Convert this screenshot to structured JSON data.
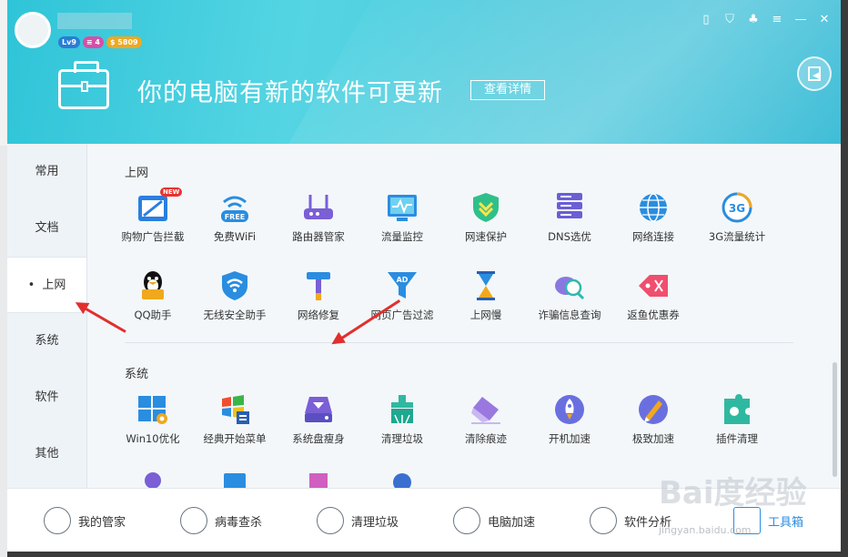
{
  "header": {
    "badges": {
      "level": "Lv9",
      "vip": "≡ 4",
      "coins": "$ 5809"
    },
    "headline": "你的电脑有新的软件可更新",
    "detail_button": "查看详情"
  },
  "sidebar": {
    "items": [
      {
        "label": "常用"
      },
      {
        "label": "文档"
      },
      {
        "label": "上网",
        "active": true
      },
      {
        "label": "系统"
      },
      {
        "label": "软件"
      },
      {
        "label": "其他"
      }
    ]
  },
  "sections": {
    "internet": {
      "title": "上网",
      "items": [
        {
          "label": "购物广告拦截",
          "icon": "ad-block-icon"
        },
        {
          "label": "免费WiFi",
          "icon": "free-wifi-icon"
        },
        {
          "label": "路由器管家",
          "icon": "router-icon"
        },
        {
          "label": "流量监控",
          "icon": "traffic-monitor-icon"
        },
        {
          "label": "网速保护",
          "icon": "speed-shield-icon"
        },
        {
          "label": "DNS选优",
          "icon": "dns-server-icon"
        },
        {
          "label": "网络连接",
          "icon": "globe-icon"
        },
        {
          "label": "3G流量统计",
          "icon": "3g-icon"
        },
        {
          "label": "QQ助手",
          "icon": "qq-penguin-icon"
        },
        {
          "label": "无线安全助手",
          "icon": "wifi-shield-icon"
        },
        {
          "label": "网络修复",
          "icon": "hammer-icon"
        },
        {
          "label": "网页广告过滤",
          "icon": "ad-funnel-icon"
        },
        {
          "label": "上网慢",
          "icon": "hourglass-icon"
        },
        {
          "label": "诈骗信息查询",
          "icon": "fraud-search-icon"
        },
        {
          "label": "返鱼优惠券",
          "icon": "coupon-tag-icon"
        }
      ],
      "new_badge": "NEW"
    },
    "system": {
      "title": "系统",
      "items": [
        {
          "label": "Win10优化",
          "icon": "windows-gear-icon"
        },
        {
          "label": "经典开始菜单",
          "icon": "start-menu-icon"
        },
        {
          "label": "系统盘瘦身",
          "icon": "disk-slim-icon"
        },
        {
          "label": "清理垃圾",
          "icon": "trash-clean-icon"
        },
        {
          "label": "清除痕迹",
          "icon": "eraser-icon"
        },
        {
          "label": "开机加速",
          "icon": "rocket-icon"
        },
        {
          "label": "极致加速",
          "icon": "speed-pen-icon"
        },
        {
          "label": "插件清理",
          "icon": "plugin-icon"
        }
      ]
    }
  },
  "footer": {
    "items": [
      {
        "label": "我的管家",
        "icon": "butler-icon"
      },
      {
        "label": "病毒查杀",
        "icon": "virus-scan-icon"
      },
      {
        "label": "清理垃圾",
        "icon": "cleanup-icon"
      },
      {
        "label": "电脑加速",
        "icon": "rocket-boost-icon"
      },
      {
        "label": "软件分析",
        "icon": "software-analysis-icon"
      },
      {
        "label": "工具箱",
        "icon": "toolbox-icon",
        "active": true
      }
    ]
  },
  "watermark": {
    "text": "Bai度经验",
    "url": "jingyan.baidu.com"
  },
  "colors": {
    "accent": "#2b8de0",
    "header": "#4cc9dc",
    "arrow": "#e0302e"
  }
}
